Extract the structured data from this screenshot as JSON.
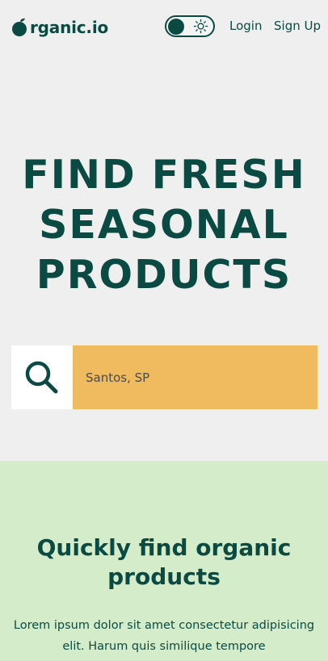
{
  "brand": {
    "logo_icon": "apple-icon",
    "name": "rganic.io"
  },
  "nav": {
    "theme_toggle_icon": "sun-icon",
    "login_label": "Login",
    "signup_label": "Sign Up"
  },
  "hero": {
    "title": "FIND FRESH SEASONAL PRODUCTS",
    "search_icon": "search-icon",
    "search_placeholder": "Santos, SP"
  },
  "feature": {
    "title": "Quickly find organic products",
    "text": "Lorem ipsum dolor sit amet consectetur adipisicing elit. Harum quis similique tempore"
  },
  "colors": {
    "primary": "#0b4a43",
    "background": "#efefef",
    "search_field": "#f0bb5e",
    "feature_background": "#d4ecc9"
  }
}
